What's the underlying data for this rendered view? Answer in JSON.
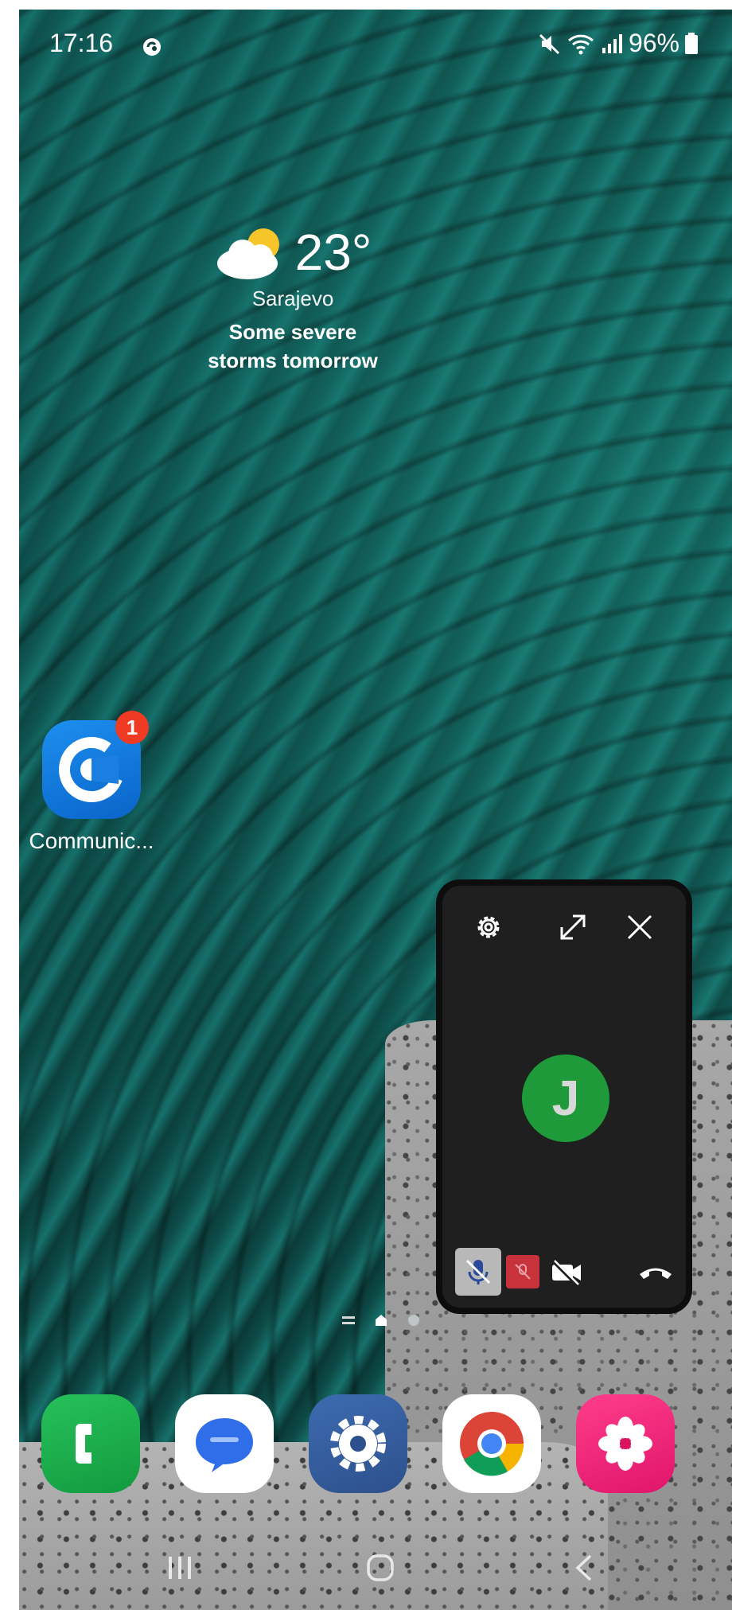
{
  "status_bar": {
    "time": "17:16",
    "battery": "96%",
    "icons": [
      "sync-icon",
      "mute-icon",
      "wifi-icon",
      "signal-icon",
      "battery-icon"
    ]
  },
  "weather": {
    "temperature": "23°",
    "city": "Sarajevo",
    "description": "Some severe storms tomorrow",
    "icon": "partly-cloudy-icon"
  },
  "home_apps": [
    {
      "label": "Communic...",
      "badge": "1",
      "icon": "communicator-icon"
    }
  ],
  "call_window": {
    "avatar_initial": "J",
    "icons": [
      "gear-icon",
      "expand-icon",
      "close-icon",
      "mic-off-icon",
      "screen-share-off-icon",
      "video-off-icon",
      "hangup-icon"
    ],
    "colors": {
      "avatar": "#1e9a3a",
      "mic_bg": "#b8b8b8",
      "share_bg": "#c8323a",
      "window_bg": "#1f1f1f"
    }
  },
  "dock": [
    "phone-icon",
    "messages-icon",
    "settings-icon",
    "chrome-icon",
    "gallery-icon"
  ],
  "nav_bar": [
    "recent-apps-icon",
    "home-icon",
    "back-icon"
  ]
}
